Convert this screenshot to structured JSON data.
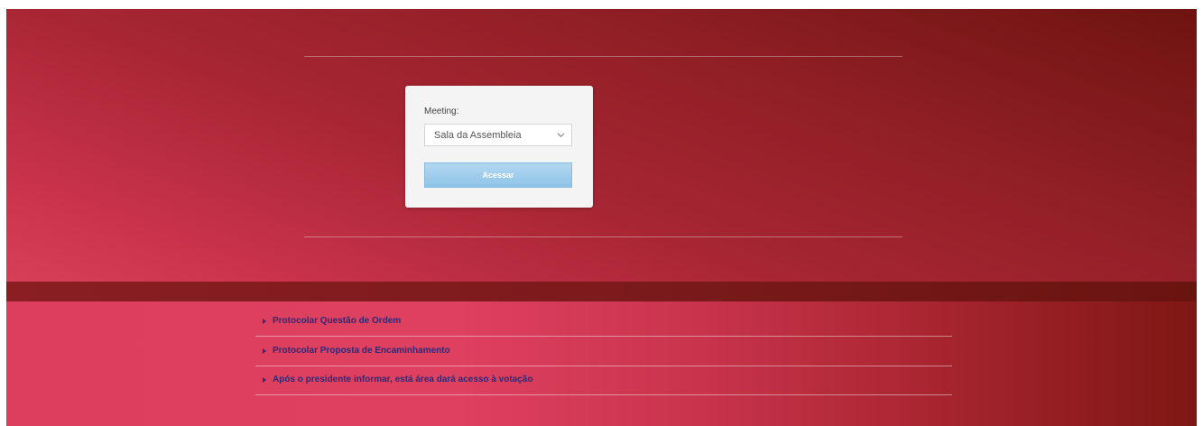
{
  "login": {
    "meeting_label": "Meeting:",
    "meeting_selected": "Sala da Assembleia",
    "access_button_label": "Acessar"
  },
  "menu": {
    "items": [
      {
        "label": "Protocolar Questão de Ordem"
      },
      {
        "label": "Protocolar Proposta de Encaminhamento"
      },
      {
        "label": "Após o presidente informar, está área dará acesso à votação"
      }
    ]
  },
  "colors": {
    "top_gradient_dark": "#6e1410",
    "top_gradient_light": "#d83e58",
    "band": "#7c1a1c",
    "bottom_gradient_pink": "#de4060",
    "bottom_gradient_dark": "#7e1714",
    "menu_text": "#2e2a78",
    "access_button": "#a3cfee"
  },
  "icons": {
    "select_chevron": "chevron-down-icon",
    "menu_bullet": "caret-right-icon"
  }
}
